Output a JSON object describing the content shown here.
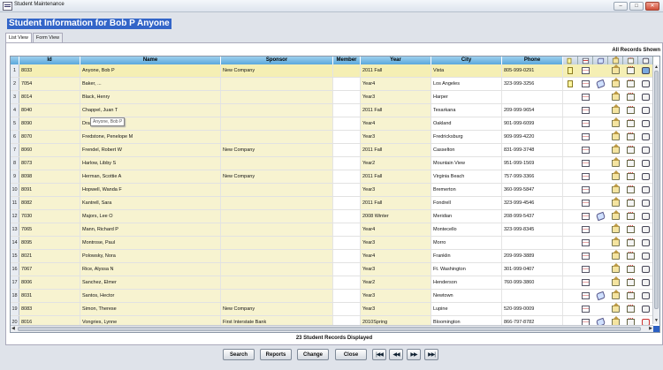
{
  "window": {
    "title": "Student Maintenance",
    "minimize": "–",
    "maximize": "□",
    "close": "✕"
  },
  "heading": "Student Information  for Bob P Anyone",
  "tabs": [
    "List View",
    "Form View"
  ],
  "all_records_label": "All Records Shown",
  "columns": [
    "Id",
    "Name",
    "Sponsor",
    "Member",
    "Year",
    "City",
    "Phone"
  ],
  "tooltip": "Anyone, Bob P",
  "rows": [
    {
      "n": "1",
      "id": "8033",
      "name": "Anyone, Bob P",
      "sponsor": "New Company",
      "year": "2011 Fall",
      "city": "Vista",
      "phone": "805-999-0291",
      "doc": true,
      "tag": false,
      "selected": true
    },
    {
      "n": "2",
      "id": "7054",
      "name": "Baker, ...",
      "sponsor": "",
      "year": "Year4",
      "city": "Los Angeles",
      "phone": "323-999-3256",
      "doc": true,
      "tag": true,
      "selected": false
    },
    {
      "n": "3",
      "id": "8014",
      "name": "Black, Henry",
      "sponsor": "",
      "year": "Year3",
      "city": "Harper",
      "phone": "",
      "doc": false,
      "tag": false,
      "selected": false
    },
    {
      "n": "4",
      "id": "8040",
      "name": "Chappel, Juan T",
      "sponsor": "",
      "year": "2011 Fall",
      "city": "Texarkana",
      "phone": "209-999-9654",
      "doc": false,
      "tag": false,
      "selected": false
    },
    {
      "n": "5",
      "id": "8090",
      "name": "Drake, Cynthia",
      "sponsor": "",
      "year": "Year4",
      "city": "Oakland",
      "phone": "901-999-6099",
      "doc": false,
      "tag": false,
      "selected": false
    },
    {
      "n": "6",
      "id": "8070",
      "name": "Fredstone, Penelope M",
      "sponsor": "",
      "year": "Year3",
      "city": "Fredricksburg",
      "phone": "909-999-4220",
      "doc": false,
      "tag": false,
      "selected": false
    },
    {
      "n": "7",
      "id": "8060",
      "name": "Frendel, Robert W",
      "sponsor": "New Company",
      "year": "2011 Fall",
      "city": "Casselton",
      "phone": "831-999-3748",
      "doc": false,
      "tag": false,
      "selected": false
    },
    {
      "n": "8",
      "id": "8073",
      "name": "Harlow, Libby S",
      "sponsor": "",
      "year": "Year2",
      "city": "Mountain View",
      "phone": "951-999-1569",
      "doc": false,
      "tag": false,
      "selected": false
    },
    {
      "n": "9",
      "id": "8098",
      "name": "Herman, Scottie A",
      "sponsor": "New Company",
      "year": "2011 Fall",
      "city": "Virginia Beach",
      "phone": "757-999-3366",
      "doc": false,
      "tag": false,
      "selected": false
    },
    {
      "n": "10",
      "id": "8091",
      "name": "Hopwell, Wanda F",
      "sponsor": "",
      "year": "Year3",
      "city": "Bremerton",
      "phone": "360-999-5847",
      "doc": false,
      "tag": false,
      "selected": false
    },
    {
      "n": "11",
      "id": "8082",
      "name": "Kantrell, Sara",
      "sponsor": "",
      "year": "2011 Fall",
      "city": "Fondrell",
      "phone": "323-999-4546",
      "doc": false,
      "tag": false,
      "selected": false
    },
    {
      "n": "12",
      "id": "7030",
      "name": "Majors, Lee O",
      "sponsor": "",
      "year": "2008 Winter",
      "city": "Meridian",
      "phone": "208-999-5437",
      "doc": false,
      "tag": true,
      "selected": false
    },
    {
      "n": "13",
      "id": "7065",
      "name": "Mann, Richard P",
      "sponsor": "",
      "year": "Year4",
      "city": "Montecello",
      "phone": "323-999-8345",
      "doc": false,
      "tag": false,
      "selected": false
    },
    {
      "n": "14",
      "id": "8095",
      "name": "Montrose, Paul",
      "sponsor": "",
      "year": "Year3",
      "city": "Morro",
      "phone": "",
      "doc": false,
      "tag": false,
      "selected": false
    },
    {
      "n": "15",
      "id": "8021",
      "name": "Polowsky, Nora",
      "sponsor": "",
      "year": "Year4",
      "city": "Franklin",
      "phone": "209-999-3889",
      "doc": false,
      "tag": false,
      "selected": false
    },
    {
      "n": "16",
      "id": "7067",
      "name": "Rice, Alyssa N",
      "sponsor": "",
      "year": "Year3",
      "city": "Ft. Washington",
      "phone": "301-999-0407",
      "doc": false,
      "tag": false,
      "selected": false
    },
    {
      "n": "17",
      "id": "8006",
      "name": "Sanchez, Elmer",
      "sponsor": "",
      "year": "Year2",
      "city": "Henderson",
      "phone": "760-999-3860",
      "doc": false,
      "tag": false,
      "selected": false
    },
    {
      "n": "18",
      "id": "8031",
      "name": "Santos, Hector",
      "sponsor": "",
      "year": "Year3",
      "city": "Newtown",
      "phone": "",
      "doc": false,
      "tag": true,
      "selected": false
    },
    {
      "n": "19",
      "id": "8083",
      "name": "Simon, Therese",
      "sponsor": "New Company",
      "year": "Year3",
      "city": "Lupine",
      "phone": "520-999-0009",
      "doc": false,
      "tag": false,
      "selected": false
    },
    {
      "n": "20",
      "id": "8016",
      "name": "Vongries, Lynne",
      "sponsor": "First Interstate Bank",
      "year": "2010Spring",
      "city": "Bloomington",
      "phone": "866-797-8782",
      "doc": false,
      "tag": true,
      "selected": false
    }
  ],
  "record_count": "23 Student Records Displayed",
  "buttons": [
    "Search",
    "Reports",
    "Change",
    "Close"
  ],
  "nav": [
    "|◀◀",
    "◀◀",
    "▶▶",
    "▶▶|"
  ],
  "colors": {
    "header_bg": "#5aa8dc",
    "selected_row": "#f5efb4",
    "title_highlight": "#3365c8"
  }
}
